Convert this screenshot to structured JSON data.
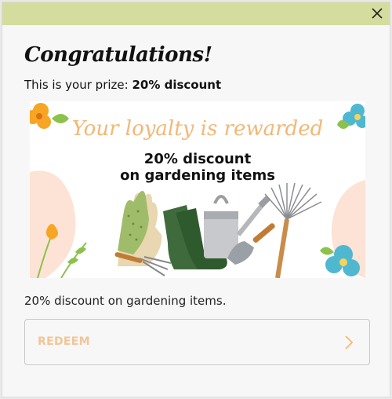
{
  "modal": {
    "title": "Congratulations!",
    "prize_prefix": "This is your prize: ",
    "prize_value": "20% discount",
    "banner": {
      "tagline": "Your loyalty is rewarded",
      "headline_1": "20% discount",
      "headline_2": "on gardening items"
    },
    "description": "20% discount on gardening items.",
    "redeem_label": "REDEEM",
    "close_icon": "close-icon",
    "chevron_icon": "chevron-right-icon"
  },
  "colors": {
    "topbar": "#d4dc9e",
    "accent": "#f2b877",
    "redeem_text": "#f2c597"
  }
}
